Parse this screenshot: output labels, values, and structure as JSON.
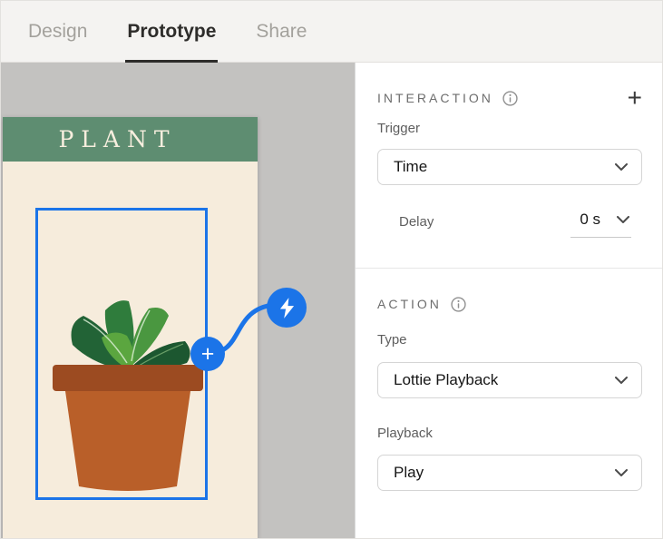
{
  "tabs": [
    {
      "label": "Design",
      "active": false
    },
    {
      "label": "Prototype",
      "active": true
    },
    {
      "label": "Share",
      "active": false
    }
  ],
  "canvas": {
    "artboard": {
      "title": "PLANT"
    }
  },
  "inspector": {
    "interaction": {
      "title": "INTERACTION",
      "trigger_label": "Trigger",
      "trigger_value": "Time",
      "delay_label": "Delay",
      "delay_value": "0 s"
    },
    "action": {
      "title": "ACTION",
      "type_label": "Type",
      "type_value": "Lottie Playback",
      "playback_label": "Playback",
      "playback_value": "Play"
    }
  },
  "icons": {
    "plus": "+",
    "info": "info-circle",
    "chevron": "chevron-down",
    "menu": "menu-bars",
    "lightning": "lightning-bolt"
  },
  "colors": {
    "accent_blue": "#1b74e8",
    "artboard_bg": "#f6ecdc",
    "header_green": "#5e8d71",
    "pot_body": "#b95f29",
    "pot_rim": "#9c4b21",
    "canvas_bg": "#c3c2c0",
    "topbar_bg": "#f4f3f1",
    "active_tab": "#2d2c2a"
  }
}
